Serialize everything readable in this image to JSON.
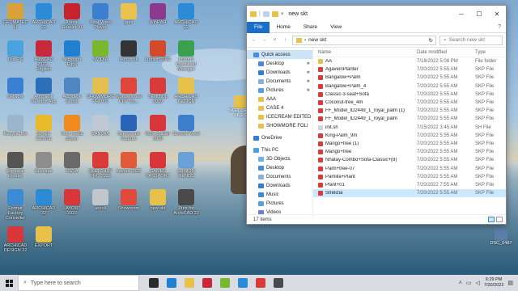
{
  "desktop": {
    "icons": [
      {
        "label": "GEOMATECH",
        "color": "#d9a13a"
      },
      {
        "label": "ARCHICAD 22",
        "color": "#2c8bd6"
      },
      {
        "label": "Adobe Reader XI",
        "color": "#c6232e"
      },
      {
        "label": "Total Video Player",
        "color": "#3b7fd1"
      },
      {
        "label": "gets",
        "color": "#e9c24f"
      },
      {
        "label": "WinRAR",
        "color": "#8b3a8f"
      },
      {
        "label": "ARCHICAD 22",
        "color": "#2c8bd6"
      },
      {
        "label": "This PC",
        "color": "#4aa3df"
      },
      {
        "label": "AutoCAD 2021 - English",
        "color": "#c8283a"
      },
      {
        "label": "Microsoft Edge",
        "color": "#1f7fd0"
      },
      {
        "label": "NVIDIA",
        "color": "#79b82e"
      },
      {
        "label": "Autodesk",
        "color": "#333333"
      },
      {
        "label": "Lumion 2022",
        "color": "#d24a2a"
      },
      {
        "label": "Internet Download Manager",
        "color": "#3aa050"
      },
      {
        "label": "Network",
        "color": "#3a7fd4"
      },
      {
        "label": "Autodesk Desktop App",
        "color": "#2b6fb6"
      },
      {
        "label": "Autodesk Studio",
        "color": "#4f86c4"
      },
      {
        "label": "SHOWMORE PHOTO",
        "color": "#e3bf50"
      },
      {
        "label": "Wondershare PDF Co...",
        "color": "#e0453a"
      },
      {
        "label": "SketchUp 2019",
        "color": "#d93a3a"
      },
      {
        "label": "ARCHICAD DESIGN",
        "color": "#e8c14a"
      },
      {
        "label": "Recycle Bin",
        "color": "#9bb5cc"
      },
      {
        "label": "Google Chrome",
        "color": "#e8b92a"
      },
      {
        "label": "VLC media player",
        "color": "#f08a1a"
      },
      {
        "label": "CANVAS",
        "color": "#bfc8d4"
      },
      {
        "label": "Screencast Capture",
        "color": "#2a64b8"
      },
      {
        "label": "Style Builder 2019",
        "color": "#d9363a"
      },
      {
        "label": "Control Panel",
        "color": "#3c7fcd"
      },
      {
        "label": "Enscape Render",
        "color": "#555555"
      },
      {
        "label": "Enscape",
        "color": "#8e8e8e"
      },
      {
        "label": "CSSA",
        "color": "#6a6a6a"
      },
      {
        "label": "SKETCHUP PRO 2022",
        "color": "#d93a3a"
      },
      {
        "label": "Layout 2022",
        "color": "#e05a3a"
      },
      {
        "label": "GAMES PASSPORT",
        "color": "#d9363a"
      },
      {
        "label": "LUMION RENDS",
        "color": "#6aa1d8"
      },
      {
        "label": "Format Factory Converter",
        "color": "#3a8ad6"
      },
      {
        "label": "ARCHICAD 22",
        "color": "#2c8bd6"
      },
      {
        "label": "LAYOUT 2022",
        "color": "#d9363a"
      },
      {
        "label": "ascoli",
        "color": "#c0c6cc"
      },
      {
        "label": "Showroom",
        "color": "#e04a3a"
      },
      {
        "label": "new skt",
        "color": "#e8c14a"
      },
      {
        "label": "Print for ArchiCAD 22",
        "color": "#4a4a4a"
      },
      {
        "label": "ARCHICAD DESIGN 22",
        "color": "#d9363a"
      },
      {
        "label": "EXPORT",
        "color": "#e8c14a"
      }
    ],
    "right_labels": [
      "SKETCHUP FILES",
      "DSC_0487"
    ]
  },
  "window": {
    "title": "new skt",
    "controls": {
      "minimize": "─",
      "maximize": "☐",
      "close": "✕"
    },
    "ribbon": {
      "file": "File",
      "tabs": [
        "Home",
        "Share",
        "View"
      ],
      "help": "?"
    },
    "address": {
      "path": "new skt",
      "search_placeholder": "Search new skt"
    },
    "nav": [
      {
        "label": "Quick access",
        "icon": "#4a8bd6",
        "sel": true,
        "pin": false,
        "sub": false
      },
      {
        "label": "Desktop",
        "icon": "#4a8bd6",
        "sel": false,
        "pin": true,
        "sub": true
      },
      {
        "label": "Downloads",
        "icon": "#2f7fd4",
        "sel": false,
        "pin": true,
        "sub": true
      },
      {
        "label": "Documents",
        "icon": "#8ab0d8",
        "sel": false,
        "pin": true,
        "sub": true
      },
      {
        "label": "Pictures",
        "icon": "#5aa0e0",
        "sel": false,
        "pin": true,
        "sub": true
      },
      {
        "label": "AAA",
        "icon": "#e8c14a",
        "sel": false,
        "pin": false,
        "sub": true
      },
      {
        "label": "CASE 4",
        "icon": "#e8c14a",
        "sel": false,
        "pin": false,
        "sub": true
      },
      {
        "label": "ICECREAM EDITED",
        "icon": "#e8c14a",
        "sel": false,
        "pin": false,
        "sub": true
      },
      {
        "label": "SHOWMORE FOLI",
        "icon": "#e8c14a",
        "sel": false,
        "pin": false,
        "sub": true
      },
      {
        "label": "OneDrive",
        "icon": "#2f7fd4",
        "sel": false,
        "pin": false,
        "sub": false,
        "gap": true
      },
      {
        "label": "This PC",
        "icon": "#4aa3df",
        "sel": false,
        "pin": false,
        "sub": false,
        "gap": true
      },
      {
        "label": "3D Objects",
        "icon": "#6fb0e8",
        "sel": false,
        "pin": false,
        "sub": true
      },
      {
        "label": "Desktop",
        "icon": "#4a8bd6",
        "sel": false,
        "pin": false,
        "sub": true
      },
      {
        "label": "Documents",
        "icon": "#8ab0d8",
        "sel": false,
        "pin": false,
        "sub": true
      },
      {
        "label": "Downloads",
        "icon": "#2f7fd4",
        "sel": false,
        "pin": false,
        "sub": true
      },
      {
        "label": "Music",
        "icon": "#3a8ad6",
        "sel": false,
        "pin": false,
        "sub": true
      },
      {
        "label": "Pictures",
        "icon": "#5aa0e0",
        "sel": false,
        "pin": false,
        "sub": true
      },
      {
        "label": "Videos",
        "icon": "#6a7fd0",
        "sel": false,
        "pin": false,
        "sub": true
      }
    ],
    "columns": {
      "name": "Name",
      "date": "Date modified",
      "type": "Type"
    },
    "files": [
      {
        "name": "AA",
        "date": "7/18/2022 5:08 PM",
        "type": "File folder",
        "icon": "#e8c14a"
      },
      {
        "name": "AgaveinPlanter",
        "date": "7/20/2022 5:55 AM",
        "type": "SKP File",
        "icon": "#d93a3a"
      },
      {
        "name": "Bangalow+Palm",
        "date": "7/20/2022 5:55 AM",
        "type": "SKP File",
        "icon": "#d93a3a"
      },
      {
        "name": "Bangalow+Palm_4",
        "date": "7/20/2022 5:55 AM",
        "type": "SKP File",
        "icon": "#d93a3a"
      },
      {
        "name": "Classic-3-seat+Sofa",
        "date": "7/20/2022 5:55 AM",
        "type": "SKP File",
        "icon": "#d93a3a"
      },
      {
        "name": "Coconut-tree_4m",
        "date": "7/20/2022 5:55 AM",
        "type": "SKP File",
        "icon": "#d93a3a"
      },
      {
        "name": "FF_Model_ID2449_1_royal_palm (1)",
        "date": "7/20/2022 5:55 AM",
        "type": "SKP File",
        "icon": "#d93a3a"
      },
      {
        "name": "FF_Model_ID2449_1_royal_palm",
        "date": "7/20/2022 5:55 AM",
        "type": "SKP File",
        "icon": "#d93a3a"
      },
      {
        "name": "init.sh",
        "date": "7/15/2022 3:45 AM",
        "type": "SH File",
        "icon": "#cfd6de"
      },
      {
        "name": "King-Palm_9m",
        "date": "7/20/2022 5:55 AM",
        "type": "SKP File",
        "icon": "#d93a3a"
      },
      {
        "name": "Mango+tree (1)",
        "date": "7/20/2022 5:55 AM",
        "type": "SKP File",
        "icon": "#d93a3a"
      },
      {
        "name": "Mango+tree",
        "date": "7/20/2022 5:55 AM",
        "type": "SKP File",
        "icon": "#d93a3a"
      },
      {
        "name": "Nhatay-Combo+Sofa-Classic+(8)",
        "date": "7/20/2022 5:55 AM",
        "type": "SKP File",
        "icon": "#d93a3a"
      },
      {
        "name": "Palm+tree-07",
        "date": "7/20/2022 5:55 AM",
        "type": "SKP File",
        "icon": "#d93a3a"
      },
      {
        "name": "Pamilla+Plant",
        "date": "7/20/2022 5:55 AM",
        "type": "SKP File",
        "icon": "#d93a3a"
      },
      {
        "name": "Plant+01",
        "date": "7/20/2022 7:55 AM",
        "type": "SKP File",
        "icon": "#d93a3a"
      },
      {
        "name": "Strelizia",
        "date": "7/20/2022 5:55 AM",
        "type": "SKP File",
        "icon": "#d93a3a",
        "sel": true
      }
    ],
    "status": "17 items"
  },
  "taskbar": {
    "search_placeholder": "Type here to search",
    "apps": [
      "#2b2b2b",
      "#1f7fd0",
      "#e8c14a",
      "#c8283a",
      "#79b82e",
      "#2c8bd6",
      "#d93a3a",
      "#4a4a4a"
    ],
    "time": "6:29 PM",
    "date": "7/20/2022"
  }
}
